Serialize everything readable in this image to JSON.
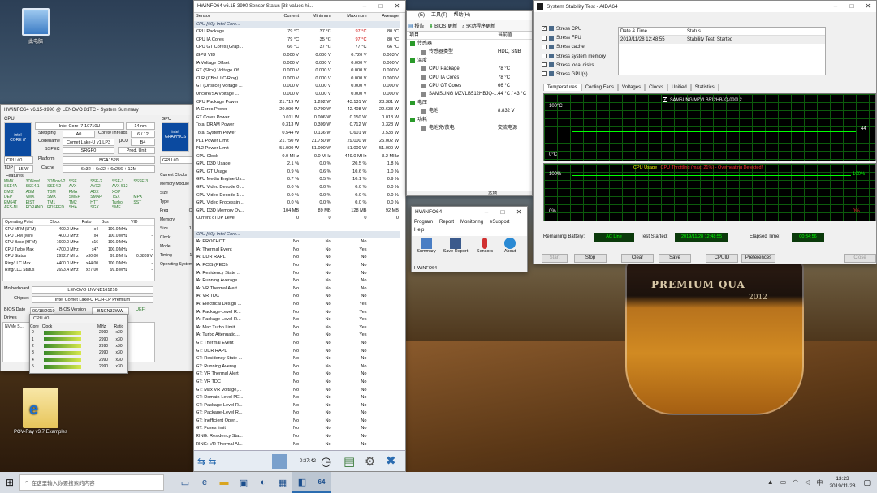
{
  "desktop": {
    "icons": [
      {
        "label": "此电脑"
      },
      {
        "label": "POV-Ray v3.7 Examples"
      }
    ]
  },
  "summary": {
    "title": "HWiNFO64 v6.15-3990 @ LENOVO 81TC - System Summary",
    "cpu_label": "CPU",
    "gpu_label": "GPU",
    "cpu_name": "Intel Core i7-10710U",
    "nm": "14 nm",
    "stepping_label": "Stepping",
    "stepping": "A0",
    "cores_label": "Cores/Threads",
    "cores": "6 / 12",
    "codename_label": "Codename",
    "codename": "Comet Lake-U v1 LP3",
    "ucu_label": "μCU",
    "ucu": "B4",
    "sspec_label": "SSPEC",
    "sspec": "SRGP0",
    "produnit": "Prod. Unit",
    "platform_label": "Platform",
    "platform": "BGA1528",
    "cache_label": "Cache",
    "cache": "6x32 + 6x32 + 6x256 + 12M",
    "cpu_sel": "CPU #0",
    "tdp_label": "TDP",
    "tdp": "15 W",
    "features_label": "Features",
    "features": [
      "MMX",
      "3DNow!",
      "3DNow!-2",
      "SSE",
      "SSE-2",
      "SSE-3",
      "SSSE-3",
      "SSE4A",
      "SSE4.1",
      "SSE4.2",
      "AVX",
      "AVX2",
      "AVX-512",
      "",
      "BMI2",
      "ABM",
      "TBM",
      "FMA",
      "ADX",
      "XOP",
      "",
      "DEP",
      "VMX",
      "SMX",
      "SMEP",
      "SMAP",
      "TSX",
      "MPX",
      "EM64T",
      "EIST",
      "TM1",
      "TM2",
      "HTT",
      "Turbo",
      "SST",
      "AES-NI",
      "RDRAND",
      "RDSEED",
      "SHA",
      "SGX",
      "SME",
      ""
    ],
    "op_headers": [
      "Operating Point",
      "Clock",
      "Ratio",
      "Bus",
      "VID"
    ],
    "op_rows": [
      [
        "CPU MFM (LFM)",
        "400.0 MHz",
        "x4",
        "100.0 MHz",
        "-"
      ],
      [
        "CPU LFM (Min)",
        "400.0 MHz",
        "x4",
        "100.0 MHz",
        "-"
      ],
      [
        "CPU Base (HFM)",
        "1600.0 MHz",
        "x16",
        "100.0 MHz",
        "-"
      ],
      [
        "CPU Turbo Max",
        "4700.0 MHz",
        "x47",
        "100.0 MHz",
        "-"
      ],
      [
        "CPU Status",
        "2992.7 MHz",
        "x30.00",
        "99.8 MHz",
        "0.8809 V"
      ],
      [
        "Ring/LLC Max",
        "4400.0 MHz",
        "x44.00",
        "100.0 MHz",
        "-"
      ],
      [
        "Ring/LLC Status",
        "2693.4 MHz",
        "x27.00",
        "99.8 MHz",
        "-"
      ]
    ],
    "mb_label": "Motherboard",
    "mb": "LENOVO LNVNB161216",
    "chipset_label": "Chipset",
    "chipset": "Intel Comet Lake-U PCH-LP Premium",
    "bios_label": "BIOS Date",
    "bios": "09/18/2019",
    "biosver_label": "BIOS Version",
    "biosver": "BNCN33WW",
    "uefi": "UEFI",
    "drives_label": "Drives",
    "drive": "NVMe S...",
    "gpu_sel": "GPU #0",
    "gpu_rows": [
      "Current Clocks",
      "Memory Module",
      "Size",
      "Type",
      "Freq",
      "Memory",
      "Size",
      "Clock",
      "Mode",
      "Timing",
      "Operating System"
    ],
    "gpu_vals": [
      "",
      "",
      "",
      "",
      "CL",
      "",
      "1E",
      "",
      "",
      "10",
      ""
    ],
    "os": "Microsoft W... 18363"
  },
  "clocks": {
    "title": "CPU #0",
    "headers": [
      "Core",
      "Clock",
      "MHz",
      "Ratio"
    ],
    "rows": [
      [
        "0",
        "",
        "2990",
        "x30"
      ],
      [
        "1",
        "",
        "2990",
        "x30"
      ],
      [
        "2",
        "",
        "2990",
        "x30"
      ],
      [
        "3",
        "",
        "2990",
        "x30"
      ],
      [
        "4",
        "",
        "2990",
        "x30"
      ],
      [
        "5",
        "",
        "2990",
        "x30"
      ]
    ]
  },
  "sensors": {
    "title": "HWiNFO64 v6.15-3990 Sensor Status [38 values hi...",
    "headers": [
      "Sensor",
      "Current",
      "Minimum",
      "Maximum",
      "Average"
    ],
    "group1": "CPU [#0]: Intel Core...",
    "rows1": [
      [
        "CPU Package",
        "79 °C",
        "37 °C",
        "97 °C",
        "80 °C",
        1
      ],
      [
        "CPU IA Cores",
        "79 °C",
        "35 °C",
        "97 °C",
        "80 °C",
        1
      ],
      [
        "CPU GT Cores (Grap...",
        "66 °C",
        "37 °C",
        "77 °C",
        "66 °C",
        0
      ],
      [
        "iGPU VID",
        "0.000 V",
        "0.000 V",
        "0.720 V",
        "0.003 V",
        0
      ],
      [
        "IA Voltage Offset",
        "0.000 V",
        "0.000 V",
        "0.000 V",
        "0.000 V",
        0
      ],
      [
        "GT (Slice) Voltage Of...",
        "0.000 V",
        "0.000 V",
        "0.000 V",
        "0.000 V",
        0
      ],
      [
        "CLR (CBo/LLC/Ring) ...",
        "0.000 V",
        "0.000 V",
        "0.000 V",
        "0.000 V",
        0
      ],
      [
        "GT (Unslice) Voltage ...",
        "0.000 V",
        "0.000 V",
        "0.000 V",
        "0.000 V",
        0
      ],
      [
        "Uncore/SA Voltage ...",
        "0.000 V",
        "0.000 V",
        "0.000 V",
        "0.000 V",
        0
      ],
      [
        "CPU Package Power",
        "21.719 W",
        "1.202 W",
        "43.131 W",
        "23.381 W",
        0
      ],
      [
        "IA Cores Power",
        "20.990 W",
        "0.700 W",
        "42.408 W",
        "22.633 W",
        0
      ],
      [
        "GT Cores Power",
        "0.011 W",
        "0.006 W",
        "0.150 W",
        "0.013 W",
        0
      ],
      [
        "Total DRAM Power",
        "0.313 W",
        "0.309 W",
        "0.712 W",
        "0.328 W",
        0
      ],
      [
        "Total System Power",
        "0.544 W",
        "0.136 W",
        "0.601 W",
        "0.533 W",
        0
      ],
      [
        "PL1 Power Limit",
        "21.750 W",
        "21.750 W",
        "29.000 W",
        "25.002 W",
        0
      ],
      [
        "PL2 Power Limit",
        "51.000 W",
        "51.000 W",
        "51.000 W",
        "51.000 W",
        0
      ],
      [
        "GPU Clock",
        "0.0 MHz",
        "0.0 MHz",
        "449.0 MHz",
        "3.2 MHz",
        0
      ],
      [
        "GPU D3D Usage",
        "2.1 %",
        "0.0 %",
        "20.5 %",
        "1.8 %",
        0
      ],
      [
        "GPU GT Usage",
        "0.9 %",
        "0.6 %",
        "10.6 %",
        "1.0 %",
        0
      ],
      [
        "GPU Media Engine Us...",
        "0.7 %",
        "0.5 %",
        "10.1 %",
        "0.9 %",
        0
      ],
      [
        "GPU Video Decode 0 ...",
        "0.0 %",
        "0.0 %",
        "0.0 %",
        "0.0 %",
        0
      ],
      [
        "GPU Video Decode 1 ...",
        "0.0 %",
        "0.0 %",
        "0.0 %",
        "0.0 %",
        0
      ],
      [
        "GPU Video Processin...",
        "0.0 %",
        "0.0 %",
        "0.0 %",
        "0.0 %",
        0
      ],
      [
        "GPU D3D Memory Dy...",
        "104 MB",
        "89 MB",
        "128 MB",
        "92 MB",
        0
      ],
      [
        "Current cTDP Level",
        "0",
        "0",
        "0",
        "0",
        0
      ]
    ],
    "group2": "CPU [#0]: Intel Core...",
    "rows2": [
      [
        "IA: PROCHOT",
        "No",
        "No",
        "No"
      ],
      [
        "IA: Thermal Event",
        "No",
        "No",
        "Yes"
      ],
      [
        "IA: DDR RAPL",
        "No",
        "No",
        "No"
      ],
      [
        "IA: PCIS (PECI)",
        "No",
        "No",
        "No"
      ],
      [
        "IA: Residency State ...",
        "No",
        "No",
        "No"
      ],
      [
        "IA: Running Average...",
        "No",
        "No",
        "No"
      ],
      [
        "IA: VR Thermal Alert",
        "No",
        "No",
        "No"
      ],
      [
        "IA: VR TDC",
        "No",
        "No",
        "No"
      ],
      [
        "IA: Electrical Design ...",
        "No",
        "No",
        "Yes"
      ],
      [
        "IA: Package-Level R...",
        "No",
        "No",
        "Yes"
      ],
      [
        "IA: Package-Level R...",
        "No",
        "No",
        "Yes"
      ],
      [
        "IA: Max Turbo Limit",
        "No",
        "No",
        "Yes"
      ],
      [
        "IA: Turbo Attenuatio...",
        "No",
        "No",
        "Yes"
      ],
      [
        "GT: Thermal Event",
        "No",
        "No",
        "No"
      ],
      [
        "GT: DDR RAPL",
        "No",
        "No",
        "No"
      ],
      [
        "GT: Residency State ...",
        "No",
        "No",
        "No"
      ],
      [
        "GT: Running Averag...",
        "No",
        "No",
        "No"
      ],
      [
        "GT: VR Thermal Alert",
        "No",
        "No",
        "No"
      ],
      [
        "GT: VR TDC",
        "No",
        "No",
        "No"
      ],
      [
        "GT: Max VR Voltage,...",
        "No",
        "No",
        "No"
      ],
      [
        "GT: Domain-Level PE...",
        "No",
        "No",
        "No"
      ],
      [
        "GT: Package-Level R...",
        "No",
        "No",
        "No"
      ],
      [
        "GT: Package-Level R...",
        "No",
        "No",
        "No"
      ],
      [
        "GT: Inefficient Oper...",
        "No",
        "No",
        "No"
      ],
      [
        "GT: Fuses limit",
        "No",
        "No",
        "No"
      ],
      [
        "RING: Residency Sta...",
        "No",
        "No",
        "No"
      ],
      [
        "RING: VR Thermal Al...",
        "No",
        "No",
        "No"
      ]
    ],
    "time": "0:37:42"
  },
  "aida": {
    "menu": [
      "(E)",
      "工具(T)",
      "帮助(H)"
    ],
    "tool_report": "报告",
    "tool_bios": "BIOS 更新",
    "tool_driver": "驱动程序更新",
    "col1": "项目",
    "col2": "当前值",
    "tree": [
      [
        "传感器",
        "",
        0,
        1
      ],
      [
        "传感器类型",
        "HDD, SNB",
        1,
        0
      ],
      [
        "",
        "",
        0,
        0
      ],
      [
        "温度",
        "",
        0,
        1
      ],
      [
        "CPU Package",
        "78 °C",
        1,
        0
      ],
      [
        "CPU IA Cores",
        "78 °C",
        1,
        0
      ],
      [
        "CPU GT Cores",
        "66 °C",
        1,
        0
      ],
      [
        "SAMSUNG MZVLB512HBJQ-...",
        "44 °C / 43 °C",
        1,
        0
      ],
      [
        "",
        "",
        0,
        0
      ],
      [
        "电压",
        "",
        0,
        1
      ],
      [
        "电池",
        "8.832 V",
        1,
        0
      ],
      [
        "",
        "",
        0,
        0
      ],
      [
        "功耗",
        "",
        0,
        1
      ],
      [
        "电池充/放电",
        "交流电源",
        1,
        0
      ]
    ],
    "status": "本地"
  },
  "mini": {
    "title": "HWiNFO64",
    "menu": [
      "Program",
      "Report",
      "Monitoring",
      "eSupport",
      "Help"
    ],
    "buttons": [
      "Summary",
      "Save Report",
      "Sensors",
      "About"
    ],
    "status": "HWiNFO64"
  },
  "stab": {
    "title": "System Stability Test - AIDA64",
    "checks": [
      [
        "Stress CPU",
        1
      ],
      [
        "Stress FPU",
        0
      ],
      [
        "Stress cache",
        0
      ],
      [
        "Stress system memory",
        0
      ],
      [
        "Stress local disks",
        0
      ],
      [
        "Stress GPU(s)",
        0
      ]
    ],
    "th_dt": "Date & Time",
    "th_st": "Status",
    "dt": "2019/11/28 12:48:55",
    "st": "Stability Test: Started",
    "tabs": [
      "Temperatures",
      "Cooling Fans",
      "Voltages",
      "Clocks",
      "Unified",
      "Statistics"
    ],
    "legend": "SAMSUNG MZVLB512HBJQ-000L2",
    "t_top": "100°C",
    "t_bot": "0°C",
    "t_val": "44",
    "usage_title": "CPU Usage",
    "throttle": "CPU Throttling (max: 21%) - Overheating Detected!",
    "p100": "100%",
    "p0": "0%",
    "rem_label": "Remaining Battery:",
    "rem": "AC Line",
    "ts_label": "Test Started:",
    "ts": "2019/11/28 12:48:55",
    "el_label": "Elapsed Time:",
    "el": "00:34:56",
    "buttons": [
      "Start",
      "Stop",
      "Clear",
      "Save",
      "CPUID",
      "Preferences",
      "Close"
    ]
  },
  "taskbar": {
    "search": "在这里输入你要搜索的内容",
    "time": "13:23",
    "date": "2019/11/28"
  },
  "colors": {
    "accent": "#2b6cb0",
    "alert": "#cc0000",
    "graph": "#00ff00"
  }
}
